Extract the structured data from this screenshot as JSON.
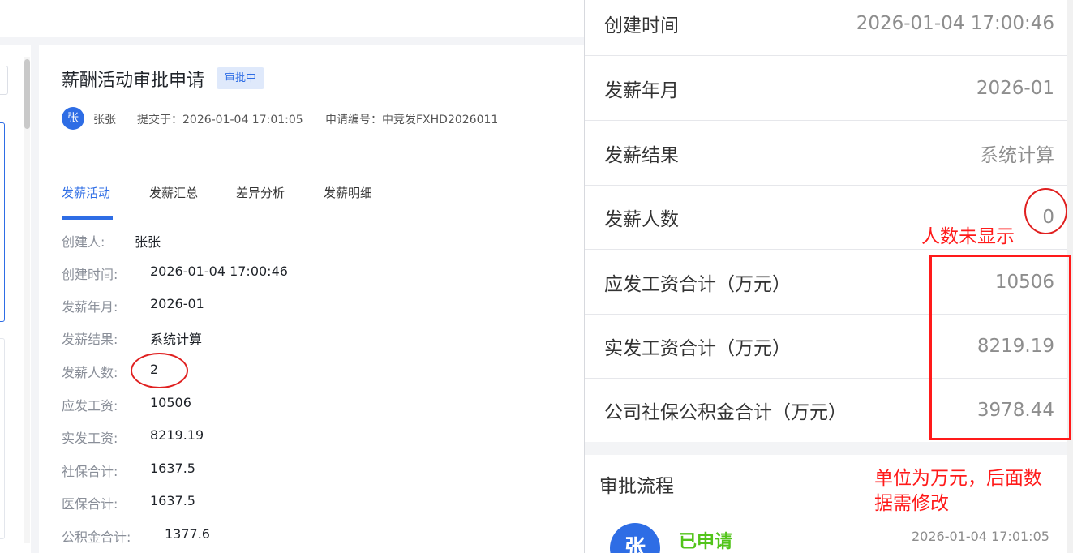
{
  "main": {
    "title": "薪酬活动审批申请",
    "status_badge": "审批中",
    "avatar_char": "张",
    "applicant": "张张",
    "submitted": "提交于：2026-01-04 17:01:05",
    "application_no": "申请编号：中竞发FXHD2026011",
    "tabs": [
      "发薪活动",
      "发薪汇总",
      "差异分析",
      "发薪明细"
    ],
    "active_tab": 0,
    "fields": [
      {
        "label": "创建人:",
        "value": "张张"
      },
      {
        "label": "创建时间:",
        "value": "2026-01-04 17:00:46"
      },
      {
        "label": "发薪年月:",
        "value": "2026-01"
      },
      {
        "label": "发薪结果:",
        "value": "系统计算"
      },
      {
        "label": "发薪人数:",
        "value": "2"
      },
      {
        "label": "应发工资:",
        "value": "10506"
      },
      {
        "label": "实发工资:",
        "value": "8219.19"
      },
      {
        "label": "社保合计:",
        "value": "1637.5"
      },
      {
        "label": "医保合计:",
        "value": "1637.5"
      },
      {
        "label": "公积金合计:",
        "value": "1377.6"
      }
    ]
  },
  "panel": {
    "rows": [
      {
        "label": "创建时间",
        "value": "2026-01-04 17:00:46"
      },
      {
        "label": "发薪年月",
        "value": "2026-01"
      },
      {
        "label": "发薪结果",
        "value": "系统计算"
      },
      {
        "label": "发薪人数",
        "value": "0"
      },
      {
        "label": "应发工资合计（万元）",
        "value": "10506"
      },
      {
        "label": "实发工资合计（万元）",
        "value": "8219.19"
      },
      {
        "label": "公司社保公积金合计（万元）",
        "value": "3978.44"
      }
    ],
    "flow": {
      "title": "审批流程",
      "avatar_char": "张",
      "status": "已申请",
      "time": "2026-01-04 17:01:05"
    }
  },
  "annotations": {
    "headcount_note": "人数未显示",
    "unit_note_line1": "单位为万元，后面数",
    "unit_note_line2": "据需修改",
    "color": "#ff1a1a"
  },
  "colors": {
    "primary": "#2e6de5",
    "success": "#52c41a"
  }
}
